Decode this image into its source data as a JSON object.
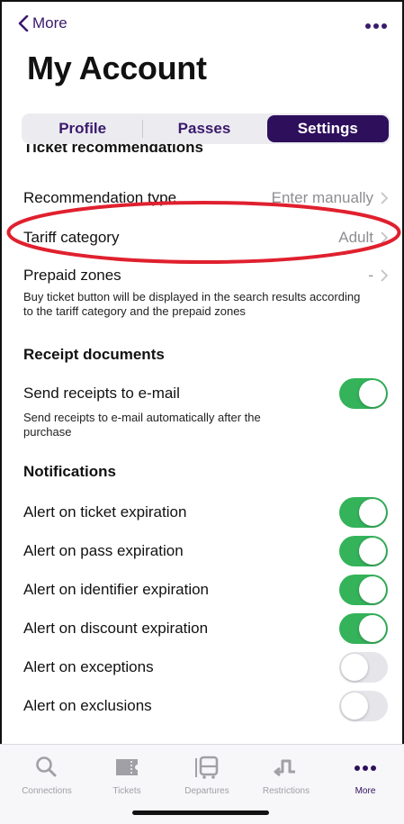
{
  "nav": {
    "back_label": "More"
  },
  "page_title": "My Account",
  "segments": [
    {
      "label": "Profile",
      "active": false
    },
    {
      "label": "Passes",
      "active": false
    },
    {
      "label": "Settings",
      "active": true
    }
  ],
  "ticket_section": {
    "header": "Ticket recommendations",
    "rows": [
      {
        "label": "Recommendation type",
        "value": "Enter manually"
      },
      {
        "label": "Tariff category",
        "value": "Adult"
      },
      {
        "label": "Prepaid zones",
        "value": "-"
      }
    ],
    "help": "Buy ticket button will be displayed in the search results according to the tariff category and the prepaid zones"
  },
  "receipt_section": {
    "header": "Receipt documents",
    "toggle_label": "Send receipts to e-mail",
    "toggle_on": true,
    "help": "Send receipts to e-mail automatically after the purchase"
  },
  "notifications": {
    "header": "Notifications",
    "items": [
      {
        "label": "Alert on ticket expiration",
        "on": true
      },
      {
        "label": "Alert on pass expiration",
        "on": true
      },
      {
        "label": "Alert on identifier expiration",
        "on": true
      },
      {
        "label": "Alert on discount expiration",
        "on": true
      },
      {
        "label": "Alert on exceptions",
        "on": false
      },
      {
        "label": "Alert on exclusions",
        "on": false
      }
    ]
  },
  "tabbar": [
    {
      "label": "Connections",
      "icon": "search-icon"
    },
    {
      "label": "Tickets",
      "icon": "ticket-icon"
    },
    {
      "label": "Departures",
      "icon": "bus-icon"
    },
    {
      "label": "Restrictions",
      "icon": "detour-icon"
    },
    {
      "label": "More",
      "icon": "more-icon",
      "active": true
    }
  ],
  "colors": {
    "accent": "#2e0f5c",
    "toggle_on": "#34b35a",
    "highlight_ellipse": "#e0202e"
  }
}
